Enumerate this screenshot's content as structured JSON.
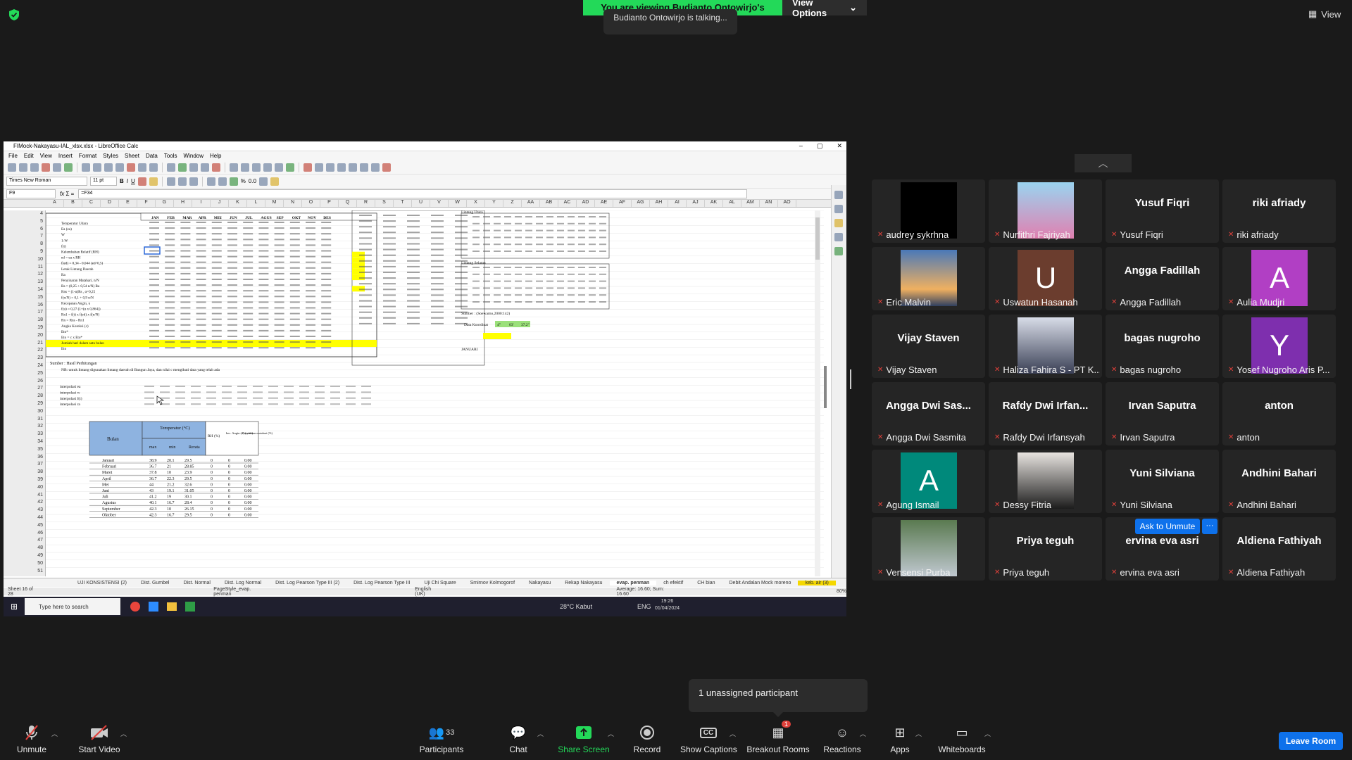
{
  "share_banner": {
    "text": "You are viewing Budianto Ontowirjo's screen",
    "options_label": "View Options",
    "talking": "Budianto Ontowirjo is talking..."
  },
  "view_label": "View",
  "calc": {
    "title": "FIMock-Nakayasu-IAL_xlsx.xlsx - LibreOffice Calc",
    "menu": [
      "File",
      "Edit",
      "View",
      "Insert",
      "Format",
      "Styles",
      "Sheet",
      "Data",
      "Tools",
      "Window",
      "Help"
    ],
    "font_name": "Times New Roman",
    "font_size": "11 pt",
    "cell_ref": "F9",
    "formula": "=F34",
    "columns": [
      "A",
      "B",
      "C",
      "D",
      "E",
      "F",
      "G",
      "H",
      "I",
      "J",
      "K",
      "L",
      "M",
      "N",
      "O",
      "P",
      "Q",
      "R",
      "S",
      "T",
      "U",
      "V",
      "W",
      "X",
      "Y",
      "Z",
      "AA",
      "AB",
      "AC",
      "AD",
      "AE",
      "AF",
      "AG",
      "AH",
      "AI",
      "AJ",
      "AK",
      "AL",
      "AM",
      "AN",
      "AO"
    ],
    "row_numbers": [
      "4",
      "5",
      "6",
      "7",
      "8",
      "9",
      "10",
      "11",
      "12",
      "13",
      "14",
      "15",
      "16",
      "17",
      "18",
      "19",
      "20",
      "21",
      "22",
      "23",
      "24",
      "25",
      "26",
      "27",
      "28",
      "29",
      "30",
      "31",
      "32",
      "33",
      "34",
      "35",
      "36",
      "37",
      "38",
      "39",
      "40",
      "41",
      "42",
      "43",
      "44",
      "45",
      "46",
      "47",
      "48",
      "49",
      "50",
      "51"
    ],
    "months": [
      "JAN",
      "FEB",
      "MAR",
      "APR",
      "MEI",
      "JUN",
      "JUL",
      "AGUS",
      "SEP",
      "OKT",
      "NOV",
      "DES"
    ],
    "param_rows": [
      "Temperatur Udara",
      "Ea (ea)",
      "W",
      "1-W",
      "f(t)",
      "Kelembaban Relatif (RH)",
      "ed = ea x RH",
      "f(ed) = 0,34 - 0,044 (ed^0,5)",
      "Letak Lintang Daerah",
      "Ra",
      "Penyinaran Matahari, n/N",
      "Rs = (0,25 + 0,54 n/N) Ra",
      "Rns = (1-α)Rs , α=0,25",
      "f(n/N) = 0,1 + 0,9 n/N",
      "Kecepatan Angin, u",
      "f(u) = 0,27 (1+(u x 0,864))",
      "Rn1 = f(t) x f(ed) x f(n/N)",
      "Rn = Rns - Rn1",
      "Angka Koreksi (c)",
      "Eto*",
      "Eto = c x Eto*",
      "Jumlah hari dalam satu bulan",
      "Eto"
    ],
    "source_note": "Sumber : Hasil Perhitungan",
    "nb_note": "NB: untuk lintang digunakan lintang daerah di Bangun Jaya, dan nilai c mengikuti data yang telah ada",
    "interp_labels": [
      "interpolasi ea",
      "interpolasi w",
      "interpolasi f(t)",
      "interpolasi ra"
    ],
    "temp_table": {
      "headers": [
        "Bulan",
        "Temperatur (°C)",
        "RH (%)",
        "kec. Angin (u) (m/dt)",
        "Penyinaran matahari (%)"
      ],
      "sub": [
        "max",
        "min",
        "Rerata"
      ],
      "rows": [
        [
          "Januari",
          "38.9",
          "20.1",
          "29.5",
          "0",
          "0",
          "0.00"
        ],
        [
          "Februari",
          "36.7",
          "21",
          "28.85",
          "0",
          "0",
          "0.00"
        ],
        [
          "Maret",
          "37.8",
          "10",
          "23.9",
          "0",
          "0",
          "0.00"
        ],
        [
          "April",
          "36.7",
          "22.3",
          "29.5",
          "0",
          "0",
          "0.00"
        ],
        [
          "Mei",
          "44",
          "21.2",
          "32.6",
          "0",
          "0",
          "0.00"
        ],
        [
          "Juni",
          "43",
          "19.1",
          "31.05",
          "0",
          "0",
          "0.00"
        ],
        [
          "Juli",
          "41.2",
          "19",
          "30.1",
          "0",
          "0",
          "0.00"
        ],
        [
          "Agustus",
          "40.1",
          "16.7",
          "28.4",
          "0",
          "0",
          "0.00"
        ],
        [
          "September",
          "42.3",
          "10",
          "26.15",
          "0",
          "0",
          "0.00"
        ],
        [
          "Oktober",
          "42.3",
          "16.7",
          "29.5",
          "0",
          "0",
          "0.00"
        ]
      ]
    },
    "right_headers": [
      "Lintang Utara",
      "Lintang Selatan"
    ],
    "right_note": "Sumber : (Soewarno,2000:142)",
    "koordinat_label": "Data Koordinat",
    "koordinat_vals": [
      "4°",
      "03'",
      "37.2\""
    ],
    "januari_label": "JANUARI",
    "sheet_tabs": [
      "UJI KONSISTENSI (2)",
      "Dist. Gumbel",
      "Dist. Normal",
      "Dist. Log Normal",
      "Dist. Log Pearson Type III (2)",
      "Dist. Log Pearson Type III",
      "Uji Chi Square",
      "Smirnov Kolmogorof",
      "Nakayasu",
      "Rekap Nakayasu",
      "evap. penman",
      "ch efektif",
      "CH bian",
      "Debit Andalan Mock moreno",
      "keb. air (3)"
    ],
    "active_tab": "evap. penman",
    "status": {
      "sheet": "Sheet 16 of 28",
      "style": "PageStyle_evap. penman",
      "lang": "English (UK)",
      "sum": "Average: 16.60; Sum: 16.60",
      "zoom": "80%"
    },
    "taskbar": {
      "search": "Type here to search",
      "weather": "28°C Kabut",
      "lang": "ENG",
      "time": "19:26",
      "date": "01/04/2024"
    }
  },
  "participants": [
    {
      "name": "audrey sykrhna",
      "big": "",
      "type": "black"
    },
    {
      "name": "Nurfithri Fajriyah",
      "big": "",
      "type": "photo-blue"
    },
    {
      "name": "Yusuf Fiqri",
      "big": "Yusuf Fiqri",
      "type": "name"
    },
    {
      "name": "riki afriady",
      "big": "riki afriady",
      "type": "name"
    },
    {
      "name": "Eric Malvin",
      "big": "",
      "type": "photo-sunset"
    },
    {
      "name": "Uswatun Hasanah",
      "big": "U",
      "type": "letter",
      "color": "#6b3d2e"
    },
    {
      "name": "Angga Fadillah",
      "big": "Angga Fadillah",
      "type": "name"
    },
    {
      "name": "Aulia Mudjri",
      "big": "A",
      "type": "letter",
      "color": "#b13fc4"
    },
    {
      "name": "Vijay Staven",
      "big": "Vijay Staven",
      "type": "name"
    },
    {
      "name": "Haliza Fahira S - PT K...",
      "big": "",
      "type": "photo-hall"
    },
    {
      "name": "bagas nugroho",
      "big": "bagas nugroho",
      "type": "name"
    },
    {
      "name": "Yosef Nugroho Aris P...",
      "big": "Y",
      "type": "letter",
      "color": "#7e2fae"
    },
    {
      "name": "Angga Dwi Sasmita",
      "big": "Angga Dwi Sas...",
      "type": "name"
    },
    {
      "name": "Rafdy Dwi Irfansyah",
      "big": "Rafdy Dwi Irfan...",
      "type": "name"
    },
    {
      "name": "Irvan Saputra",
      "big": "Irvan Saputra",
      "type": "name"
    },
    {
      "name": "anton",
      "big": "anton",
      "type": "name"
    },
    {
      "name": "Agung Ismail",
      "big": "A",
      "type": "letter",
      "color": "#00897b"
    },
    {
      "name": "Dessy Fitria",
      "big": "",
      "type": "photo-hijab"
    },
    {
      "name": "Yuni Silviana",
      "big": "Yuni Silviana",
      "type": "name"
    },
    {
      "name": "Andhini Bahari",
      "big": "Andhini Bahari",
      "type": "name"
    },
    {
      "name": "Vensensi Purba",
      "big": "",
      "type": "photo-street"
    },
    {
      "name": "Priya teguh",
      "big": "Priya teguh",
      "type": "name"
    },
    {
      "name": "ervina eva asri",
      "big": "ervina eva asri",
      "type": "name"
    },
    {
      "name": "Aldiena Fathiyah",
      "big": "Aldiena Fathiyah",
      "type": "name"
    }
  ],
  "ask_unmute": "Ask to Unmute",
  "more": "···",
  "unassigned": "1 unassigned participant",
  "toolbar": {
    "unmute": "Unmute",
    "start_video": "Start Video",
    "participants": "Participants",
    "participants_count": "33",
    "chat": "Chat",
    "share": "Share Screen",
    "record": "Record",
    "captions": "Show Captions",
    "breakout": "Breakout Rooms",
    "breakout_badge": "1",
    "reactions": "Reactions",
    "apps": "Apps",
    "whiteboards": "Whiteboards",
    "leave": "Leave Room"
  },
  "colors": {
    "zoom_green": "#23d959",
    "zoom_blue": "#0e71eb",
    "mute_red": "#e0413b",
    "excel_yellow": "#ffff00",
    "table_blue": "#8eb3e0"
  }
}
